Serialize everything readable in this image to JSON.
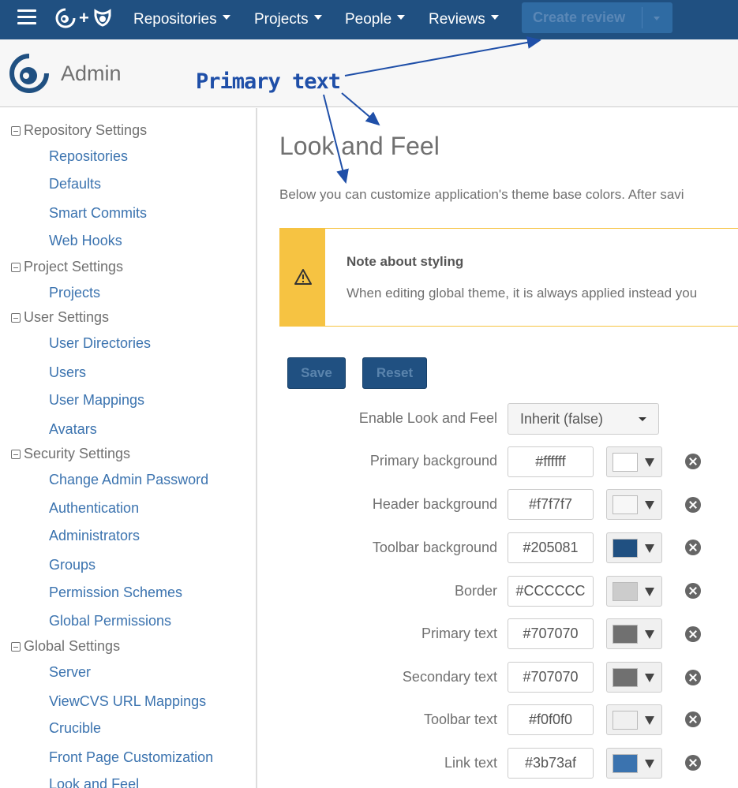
{
  "nav": {
    "menus": [
      {
        "label": "Repositories"
      },
      {
        "label": "Projects"
      },
      {
        "label": "People"
      },
      {
        "label": "Reviews"
      }
    ],
    "create_review": "Create review"
  },
  "header": {
    "title": "Admin"
  },
  "sidebar": {
    "sections": [
      {
        "label": "Repository Settings",
        "items": [
          "Repositories",
          "Defaults",
          "Smart Commits",
          "Web Hooks"
        ]
      },
      {
        "label": "Project Settings",
        "items": [
          "Projects"
        ]
      },
      {
        "label": "User Settings",
        "items": [
          "User Directories",
          "Users",
          "User Mappings",
          "Avatars"
        ]
      },
      {
        "label": "Security Settings",
        "items": [
          "Change Admin Password",
          "Authentication",
          "Administrators",
          "Groups",
          "Permission Schemes",
          "Global Permissions"
        ]
      },
      {
        "label": "Global Settings",
        "items": [
          "Server",
          "ViewCVS URL Mappings",
          "Crucible",
          "Front Page Customization",
          "Look and Feel"
        ]
      }
    ]
  },
  "main": {
    "title": "Look and Feel",
    "intro": "Below you can customize application's theme base colors. After savi",
    "note": {
      "title": "Note about styling",
      "body": "When editing global theme, it is always applied instead you"
    },
    "save_label": "Save",
    "reset_label": "Reset",
    "enable": {
      "label": "Enable Look and Feel",
      "value": "Inherit (false)"
    },
    "colors": [
      {
        "label": "Primary background",
        "value": "#ffffff",
        "swatch": "#ffffff"
      },
      {
        "label": "Header background",
        "value": "#f7f7f7",
        "swatch": "#f7f7f7"
      },
      {
        "label": "Toolbar background",
        "value": "#205081",
        "swatch": "#205081"
      },
      {
        "label": "Border",
        "value": "#CCCCCC",
        "swatch": "#cccccc"
      },
      {
        "label": "Primary text",
        "value": "#707070",
        "swatch": "#707070"
      },
      {
        "label": "Secondary text",
        "value": "#707070",
        "swatch": "#707070"
      },
      {
        "label": "Toolbar text",
        "value": "#f0f0f0",
        "swatch": "#f0f0f0"
      },
      {
        "label": "Link text",
        "value": "#3b73af",
        "swatch": "#3b73af"
      }
    ]
  },
  "annotation": {
    "text": "Primary text"
  },
  "theme": {
    "toolbar_bg": "#205081",
    "link": "#3b73af",
    "text": "#707070",
    "warning": "#f6c342",
    "annotation": "#1f4fa8"
  }
}
